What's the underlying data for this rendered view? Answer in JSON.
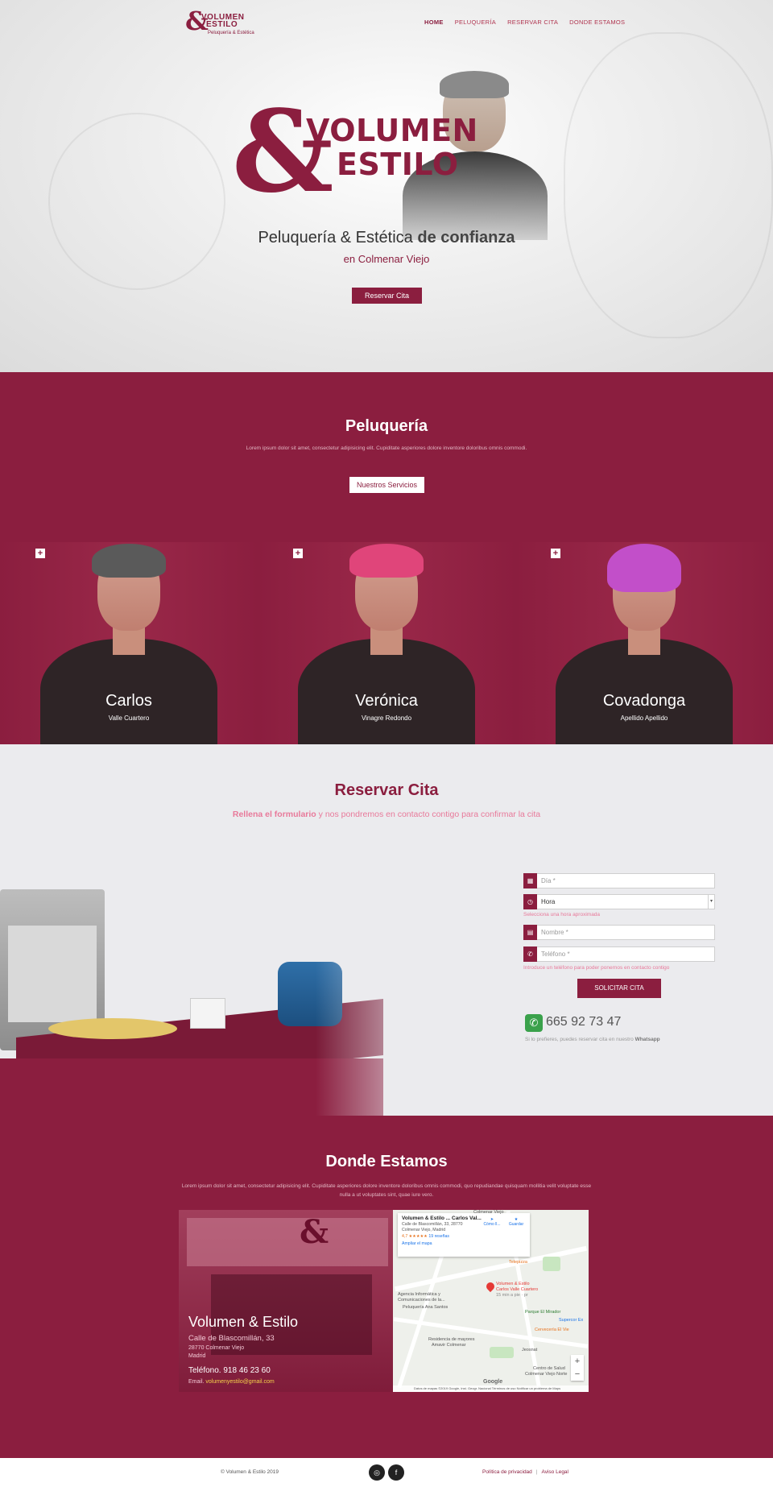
{
  "nav": {
    "logo": {
      "amp": "&",
      "line1": "VOLUMEN",
      "line2": "ESTILO",
      "tagline": "Peluquería & Estética"
    },
    "items": [
      {
        "label": "HOME",
        "active": true
      },
      {
        "label": "PELUQUERÍA",
        "active": false
      },
      {
        "label": "RESERVAR CITA",
        "active": false
      },
      {
        "label": "DONDE ESTAMOS",
        "active": false
      }
    ]
  },
  "hero": {
    "logo": {
      "amp": "&",
      "line1": "VOLUMEN",
      "line2": "ESTILO"
    },
    "title_strong": "Peluquería & Estética",
    "title_rest": " de confianza",
    "subtitle": "en Colmenar Viejo",
    "button": "Reservar Cita"
  },
  "peluqueria": {
    "title": "Peluquería",
    "description": "Lorem ipsum dolor sit amet, consectetur adipisicing elit. Cupiditate asperiores dolore inventore doloribus omnis commodi.",
    "button": "Nuestros Servicios",
    "plus_icon": "+",
    "team": [
      {
        "name": "Carlos",
        "surname": "Valle Cuartero",
        "hair_color": "#5a5a5a"
      },
      {
        "name": "Verónica",
        "surname": "Vinagre Redondo",
        "hair_color": "#e0457a"
      },
      {
        "name": "Covadonga",
        "surname": "Apellido Apellido",
        "hair_color": "#c24fc9"
      }
    ]
  },
  "reservar": {
    "title": "Reservar Cita",
    "subtitle_strong": "Rellena el formulario",
    "subtitle_rest": " y nos pondremos en contacto contigo para confirmar la cita",
    "form": {
      "dia_placeholder": "Día *",
      "hora_value": "Hora",
      "hora_hint": "Selecciona una hora aproximada",
      "nombre_placeholder": "Nombre *",
      "telefono_placeholder": "Teléfono *",
      "telefono_hint": "Introduce un teléfono para poder ponernos en contacto contigo",
      "submit": "SOLICITAR CITA"
    },
    "whatsapp": {
      "phone": "665 92 73 47",
      "note_prefix": "Si lo prefieres, puedes reservar cita en nuestro ",
      "note_strong": "Whatsapp"
    }
  },
  "donde": {
    "title": "Donde Estamos",
    "description": "Lorem ipsum dolor sit amet, consectetur adipisicing elit. Cupiditate asperiores dolore inventore doloribus omnis commodi, quo repudiandae quisquam mollitia velit voluptate esse nulla a ut voluptates sint, quae iure vero.",
    "shop_amp": "&",
    "name": "Volumen & Estilo",
    "street": "Calle de Blascomillán, 33",
    "city": "28770 Colmenar Viejo",
    "province": "Madrid",
    "phone": "Teléfono. 918 46 23 60",
    "email_label": "Email. ",
    "email": "volumenyestilo@gmail.com",
    "map": {
      "card_title": "Volumen & Estilo ... Carlos Val...",
      "card_address_1": "Calle de Blascomillán, 33, 28770",
      "card_address_2": "Colmenar Viejo, Madrid",
      "card_rating": "4,7 ★★★★★",
      "card_reviews": "19 reseñas",
      "card_link": "Ampliar el mapa",
      "act_directions": "Cómo ll...",
      "act_save": "Guardar",
      "pin_label_1": "Volumen & Estilo",
      "pin_label_2": "Carlos Valle Cuartero",
      "pin_label_3": "15 min a pie · pr",
      "places": [
        "Telepizza",
        "Agencia Informática y",
        "Comunicaciones de la...",
        "Peluquería Ana Santos",
        "Parque El Mirador",
        "Supercor Ex",
        "Cervecería El Vie",
        "Residencia de mayores",
        "Amavir Colmenar",
        "Jeosnat",
        "Centro de Salud",
        "Colmenar Viejo Norte",
        "Colmenar Viejo"
      ],
      "zoom_in": "+",
      "zoom_out": "−",
      "google": "Google",
      "footer": "Datos de mapas ©2019 Google, Inst. Geogr. Nacional   Términos de uso   Notificar un problema de Maps"
    }
  },
  "footer": {
    "copyright": "© Volumen & Estilo 2019",
    "instagram_icon": "◎",
    "facebook_icon": "f",
    "privacy": "Política de privacidad",
    "separator": "|",
    "legal": "Aviso Legal"
  },
  "colors": {
    "brand": "#8b1e3f",
    "accent_pink": "#e8799a",
    "whatsapp": "#3aa14b",
    "email": "#f5d24a"
  }
}
